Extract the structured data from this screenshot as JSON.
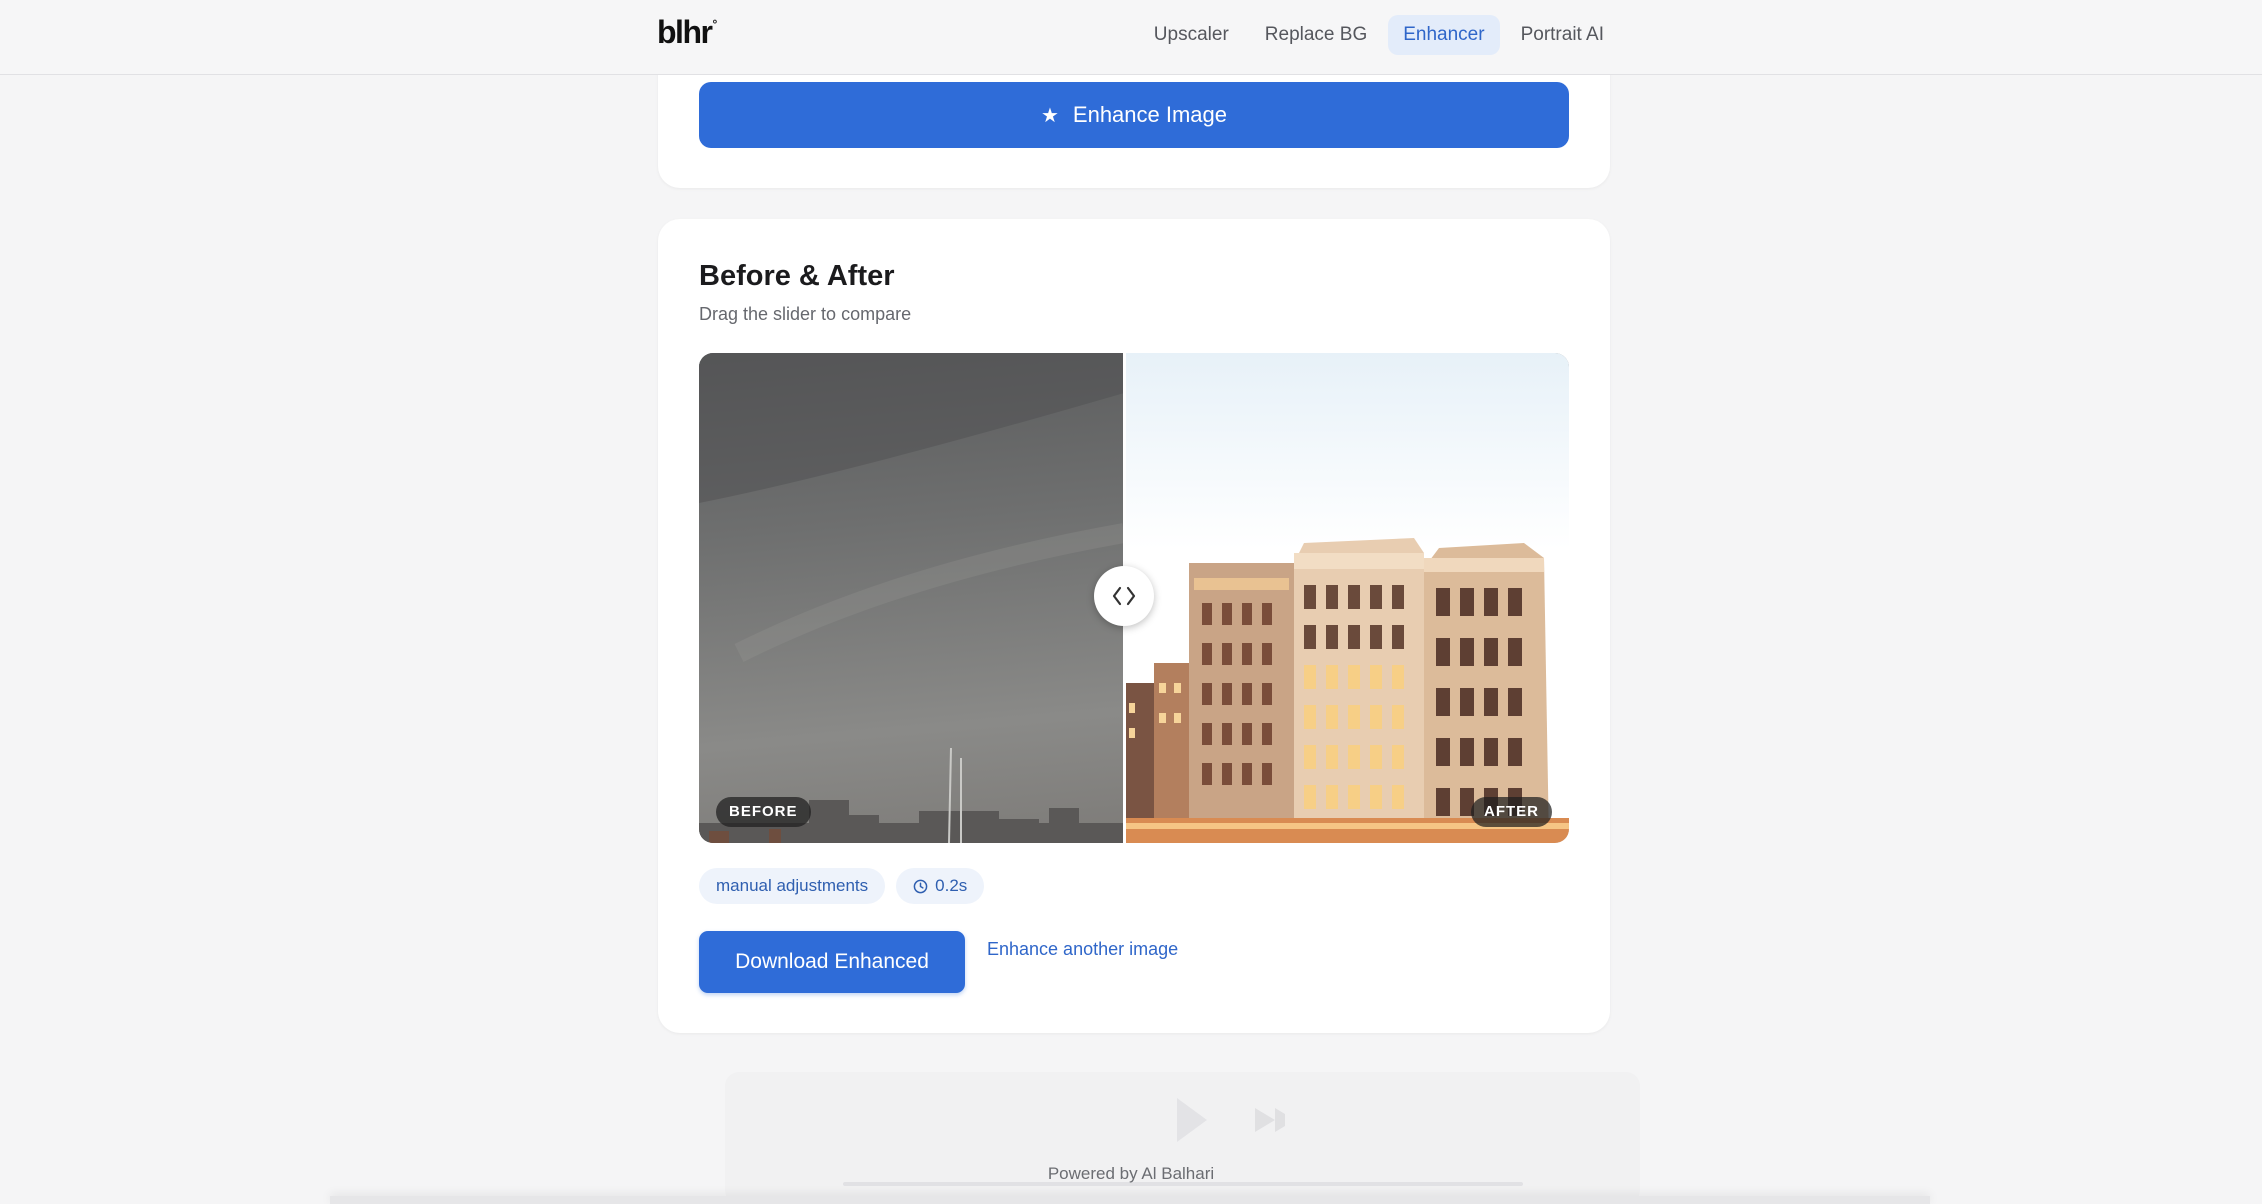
{
  "header": {
    "logo": "blhr",
    "logo_mark": "°",
    "nav": [
      {
        "label": "Upscaler",
        "active": false
      },
      {
        "label": "Replace BG",
        "active": false
      },
      {
        "label": "Enhancer",
        "active": true
      },
      {
        "label": "Portrait AI",
        "active": false
      }
    ]
  },
  "enhance": {
    "button_label": "Enhance Image",
    "icon": "star-icon"
  },
  "result": {
    "title": "Before & After",
    "subtitle": "Drag the slider to compare",
    "compare": {
      "before_label": "BEFORE",
      "after_label": "AFTER",
      "slider_position": 0.49,
      "handle_icon": "chevrons-left-right-icon"
    },
    "chips": [
      {
        "label": "manual adjustments"
      },
      {
        "label": "0.2s",
        "icon": "clock-icon"
      }
    ],
    "download_label": "Download Enhanced",
    "another_label": "Enhance another image"
  },
  "footer": {
    "text": "Powered by Al Balhari"
  },
  "colors": {
    "accent": "#2f6cd8",
    "nav_active_bg": "#e3ecfa",
    "nav_active_text": "#2f66c9"
  }
}
